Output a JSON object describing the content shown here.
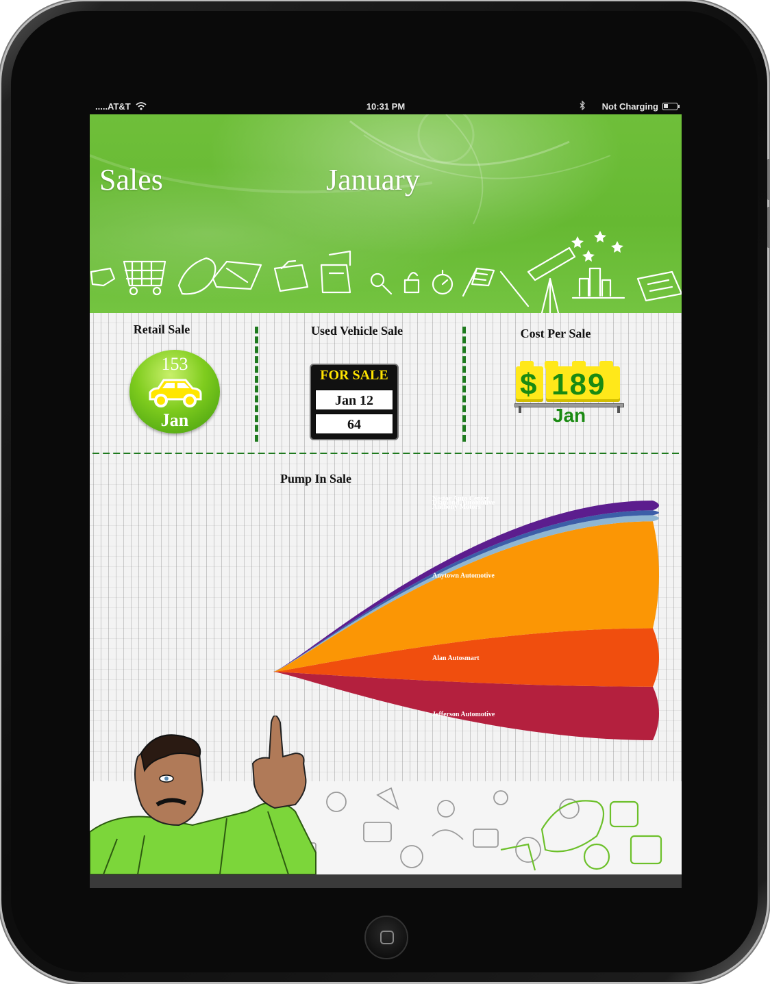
{
  "status_bar": {
    "carrier": ".....AT&T",
    "time": "10:31 PM",
    "battery_status": "Not Charging",
    "icons": [
      "wifi-icon",
      "bluetooth-icon",
      "battery-icon"
    ]
  },
  "header": {
    "title": "Sales",
    "month": "January"
  },
  "widgets": {
    "retail_sale": {
      "title": "Retail Sale",
      "value": "153",
      "month": "Jan"
    },
    "used_vehicle_sale": {
      "title": "Used Vehicle Sale",
      "sign_label": "FOR SALE",
      "date": "Jan 12",
      "value": "64"
    },
    "cost_per_sale": {
      "title": "Cost Per Sale",
      "currency": "$",
      "value": "189",
      "month": "Jan"
    }
  },
  "colors": {
    "header_green": "#6cbd38",
    "divider_green": "#1e7a1e",
    "price_yellow": "#ffe81a",
    "price_green": "#1a8a12"
  },
  "chart_data": {
    "type": "area",
    "title": "Pump In Sale",
    "note": "funnel-style stacked stream chart; values are relative layer thicknesses at the wide end",
    "series": [
      {
        "name": "Jefferson Automotive",
        "value": 0.22,
        "color": "#b4203e"
      },
      {
        "name": "Alan Autosmart",
        "value": 0.24,
        "color": "#f04e0e"
      },
      {
        "name": "Anytown Automotive",
        "value": 0.44,
        "color": "#fb9605"
      },
      {
        "name": "Anthony Motors",
        "value": 0.025,
        "color": "#8fb6d2"
      },
      {
        "name": "Diamond Automotive",
        "value": 0.02,
        "color": "#3c5ea8"
      },
      {
        "name": "Nestor Auto Center",
        "value": 0.04,
        "color": "#5c1d8e"
      }
    ]
  }
}
